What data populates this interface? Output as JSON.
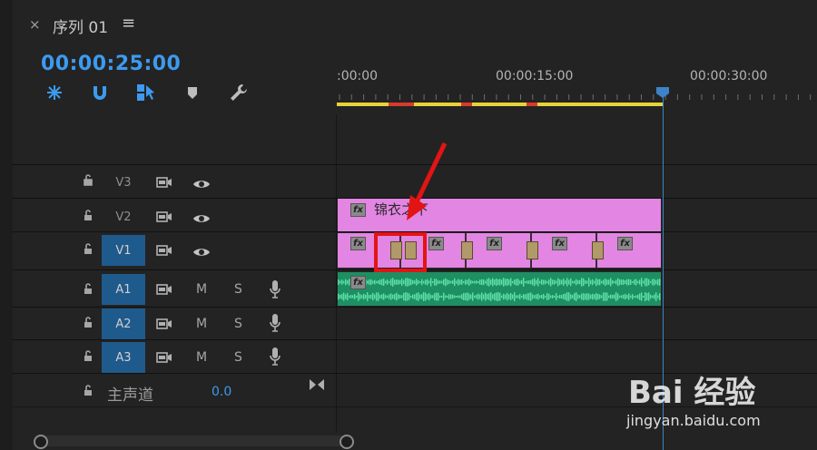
{
  "panel": {
    "close": "×",
    "title": "序列 01",
    "menu": "≡"
  },
  "timecode": "00:00:25:00",
  "toolbar": [
    {
      "icon": "nest-snap-icon"
    },
    {
      "icon": "magnet-snap-icon"
    },
    {
      "icon": "linked-selection-icon"
    },
    {
      "icon": "add-marker-icon"
    },
    {
      "icon": "wrench-settings-icon"
    }
  ],
  "ruler": {
    "labels": [
      ":00:00",
      "00:00:15:00",
      "00:00:30:00"
    ]
  },
  "tracks": {
    "v3": {
      "name": "V3"
    },
    "v2": {
      "name": "V2"
    },
    "v1": {
      "name": "V1"
    },
    "a1": {
      "name": "A1",
      "m": "M",
      "s": "S"
    },
    "a2": {
      "name": "A2",
      "m": "M",
      "s": "S"
    },
    "a3": {
      "name": "A3",
      "m": "M",
      "s": "S"
    }
  },
  "master": {
    "label": "主声道",
    "value": "0.0"
  },
  "clips": {
    "v2_title": "锦衣之下",
    "fx_label": "fx"
  },
  "colors": {
    "accent": "#3d9aef",
    "video_clip": "#e385e2",
    "audio_clip": "#1d8f63",
    "highlight": "#e21414"
  },
  "watermark": {
    "logo": "Bai 经验",
    "url": "jingyan.baidu.com"
  }
}
